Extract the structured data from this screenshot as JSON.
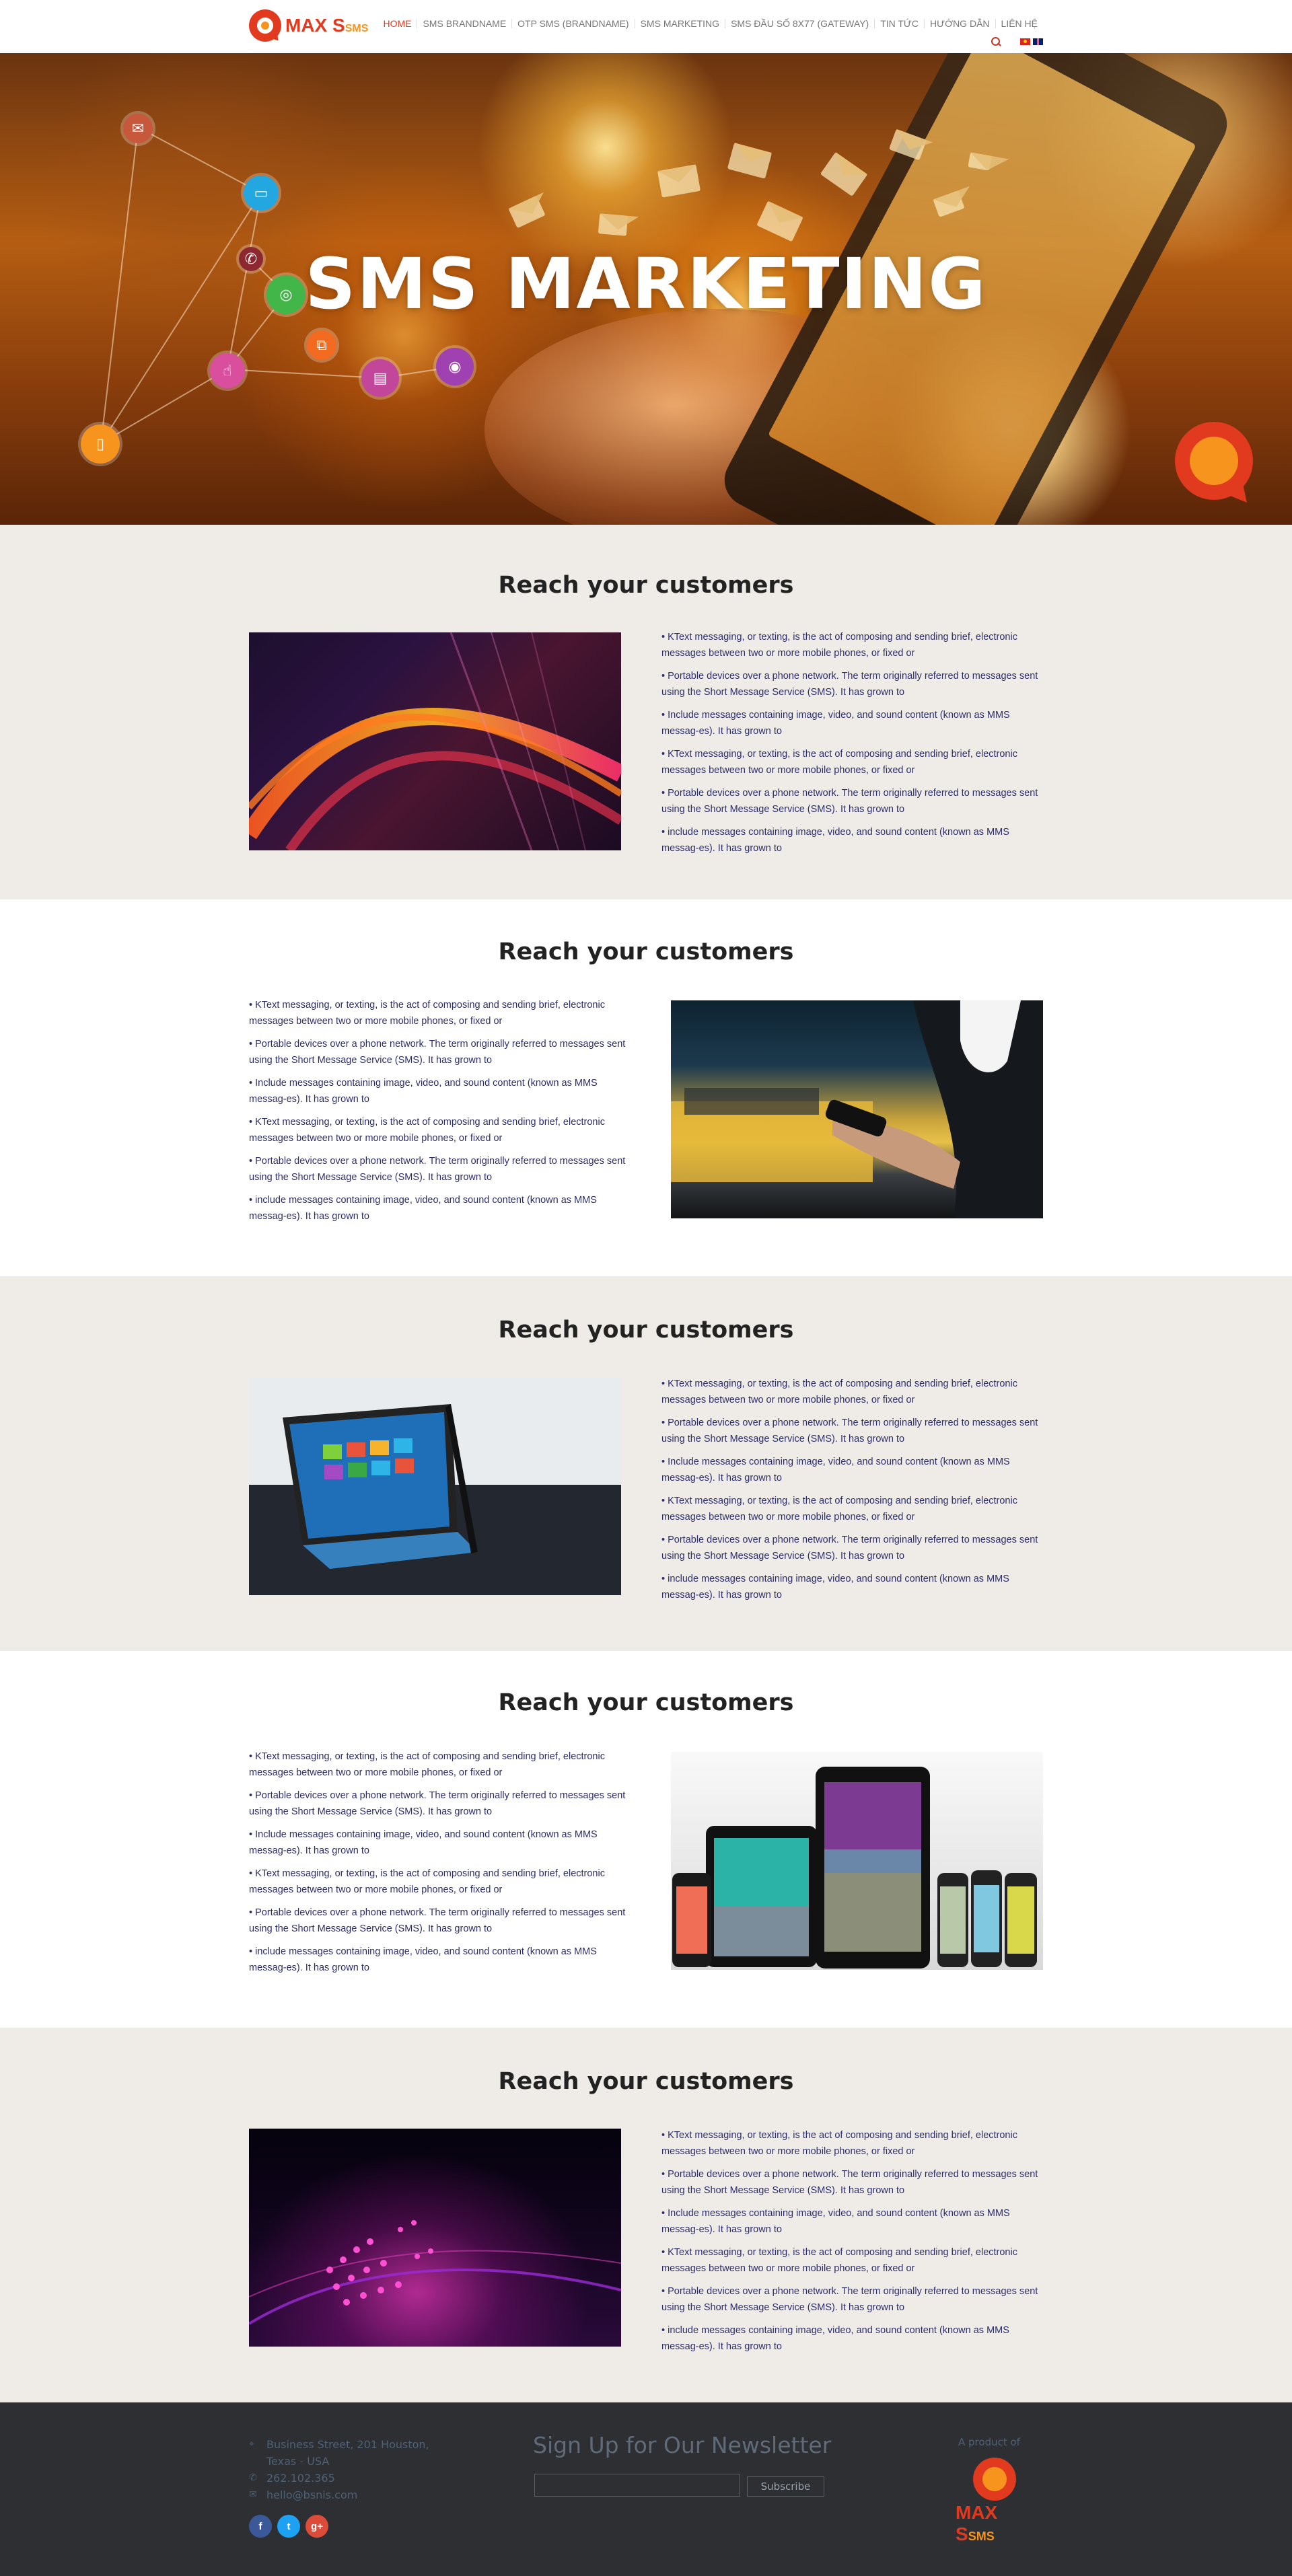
{
  "header": {
    "logo_main": "MAX S",
    "logo_sub": "SMS",
    "nav": [
      {
        "label": "HOME",
        "active": true
      },
      {
        "label": "SMS BRANDNAME",
        "active": false
      },
      {
        "label": "OTP SMS (BRANDNAME)",
        "active": false
      },
      {
        "label": "SMS MARKETING",
        "active": false
      },
      {
        "label": "SMS ĐẦU SỐ 8X77 (GATEWAY)",
        "active": false
      },
      {
        "label": "TIN TỨC",
        "active": false
      },
      {
        "label": "HƯỚNG DẪN",
        "active": false
      },
      {
        "label": "LIÊN HỆ",
        "active": false
      }
    ],
    "icons": [
      "search-icon",
      "flag-vn-icon",
      "flag-en-icon"
    ]
  },
  "hero": {
    "title": "SMS MARKETING",
    "icons": [
      "mail-icon",
      "monitor-icon",
      "phone-icon",
      "wifi-icon",
      "sitemap-icon",
      "cursor-icon",
      "web-icon",
      "podcast-icon",
      "mobile-icon"
    ]
  },
  "sections": [
    {
      "title": "Reach your customers",
      "image": "abstract-wave-image",
      "paragraphs": [
        "• KText messaging, or texting, is the act of composing and sending brief, electronic messages between two or more mobile phones, or fixed or",
        "• Portable devices over a phone network. The term originally referred to messages sent using the Short Message Service (SMS). It has grown to",
        "• Include messages containing image, video, and sound content (known as MMS messag-es). It has grown to",
        "• KText messaging, or texting, is the act of composing and sending brief, electronic messages between two or more mobile phones, or fixed or",
        "• Portable devices over a phone network. The term originally referred to messages sent using the Short Message Service (SMS). It has grown to",
        "• include messages containing image, video, and sound content (known as MMS messag-es). It has grown to"
      ]
    },
    {
      "title": "Reach your customers",
      "image": "phone-in-hand-image",
      "paragraphs": [
        "• KText messaging, or texting, is the act of composing and sending brief, electronic messages between two or more mobile phones, or fixed or",
        "• Portable devices over a phone network. The term originally referred to messages sent using the Short Message Service (SMS). It has grown to",
        "• Include messages containing image, video, and sound content (known as MMS messag-es). It has grown to",
        "• KText messaging, or texting, is the act of composing and sending brief, electronic messages between two or more mobile phones, or fixed or",
        "• Portable devices over a phone network. The term originally referred to messages sent using the Short Message Service (SMS). It has grown to",
        "• include messages containing image, video, and sound content (known as MMS messag-es). It has grown to"
      ]
    },
    {
      "title": "Reach your customers",
      "image": "tablet-image",
      "paragraphs": [
        "• KText messaging, or texting, is the act of composing and sending brief, electronic messages between two or more mobile phones, or fixed or",
        "• Portable devices over a phone network. The term originally referred to messages sent using the Short Message Service (SMS). It has grown to",
        "• Include messages containing image, video, and sound content (known as MMS messag-es). It has grown to",
        "• KText messaging, or texting, is the act of composing and sending brief, electronic messages between two or more mobile phones, or fixed or",
        "• Portable devices over a phone network. The term originally referred to messages sent using the Short Message Service (SMS). It has grown to",
        "• include messages containing image, video, and sound content (known as MMS messag-es). It has grown to"
      ]
    },
    {
      "title": "Reach your customers",
      "image": "devices-image",
      "paragraphs": [
        "• KText messaging, or texting, is the act of composing and sending brief, electronic messages between two or more mobile phones, or fixed or",
        "• Portable devices over a phone network. The term originally referred to messages sent using the Short Message Service (SMS). It has grown to",
        "• Include messages containing image, video, and sound content (known as MMS messag-es). It has grown to",
        "• KText messaging, or texting, is the act of composing and sending brief, electronic messages between two or more mobile phones, or fixed or",
        "• Portable devices over a phone network. The term originally referred to messages sent using the Short Message Service (SMS). It has grown to",
        "• include messages containing image, video, and sound content (known as MMS messag-es). It has grown to"
      ]
    },
    {
      "title": "Reach your customers",
      "image": "purple-lights-image",
      "paragraphs": [
        "• KText messaging, or texting, is the act of composing and sending brief, electronic messages between two or more mobile phones, or fixed or",
        "• Portable devices over a phone network. The term originally referred to messages sent using the Short Message Service (SMS). It has grown to",
        "• Include messages containing image, video, and sound content (known as MMS messag-es). It has grown to",
        "• KText messaging, or texting, is the act of composing and sending brief, electronic messages between two or more mobile phones, or fixed or",
        "• Portable devices over a phone network. The term originally referred to messages sent using the Short Message Service (SMS). It has grown to",
        "• include messages containing image, video, and sound content (known as MMS messag-es). It has grown to"
      ]
    }
  ],
  "footer": {
    "address_line1": "Business Street, 201 Houston,",
    "address_line2": "Texas - USA",
    "phone": "262.102.365",
    "email": "hello@bsnis.com",
    "socials": [
      {
        "label": "f",
        "color": "#3b5998"
      },
      {
        "label": "t",
        "color": "#1da1f2"
      },
      {
        "label": "g+",
        "color": "#dd4b39"
      }
    ],
    "newsletter_title": "Sign Up for Our Newsletter",
    "newsletter_placeholder": "",
    "subscribe_label": "Subscribe",
    "product_label": "A product of",
    "product_logo_main": "MAX S",
    "product_logo_sub": "SMS"
  },
  "colors": {
    "brand_red": "#e23a1e",
    "brand_orange": "#f7941d",
    "section_grey": "#efebe7",
    "body_text": "#2c2e6a",
    "footer_bg": "#2d2f33"
  }
}
